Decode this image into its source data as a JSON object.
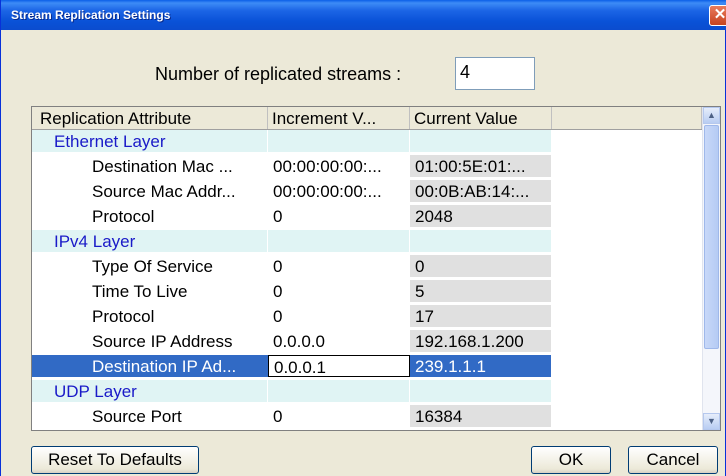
{
  "window": {
    "title": "Stream Replication Settings"
  },
  "num_streams": {
    "label": "Number of replicated streams  :",
    "value": "4"
  },
  "columns": [
    "Replication Attribute",
    "Increment V...",
    "Current Value"
  ],
  "rows": [
    {
      "attr": "Ethernet Layer",
      "incr": "",
      "cur": "",
      "group": true
    },
    {
      "attr": "Destination Mac ...",
      "incr": "00:00:00:00:...",
      "cur": "01:00:5E:01:..."
    },
    {
      "attr": "Source Mac Addr...",
      "incr": "00:00:00:00:...",
      "cur": "00:0B:AB:14:..."
    },
    {
      "attr": "Protocol",
      "incr": "0",
      "cur": "2048"
    },
    {
      "attr": "IPv4 Layer",
      "incr": "",
      "cur": "",
      "group": true
    },
    {
      "attr": "Type Of Service",
      "incr": "0",
      "cur": "0"
    },
    {
      "attr": "Time To Live",
      "incr": "0",
      "cur": "5"
    },
    {
      "attr": "Protocol",
      "incr": "0",
      "cur": "17"
    },
    {
      "attr": "Source IP Address",
      "incr": "0.0.0.0",
      "cur": "192.168.1.200"
    },
    {
      "attr": "Destination IP Ad...",
      "incr": "0.0.0.1",
      "cur": "239.1.1.1",
      "selected": true
    },
    {
      "attr": "UDP Layer",
      "incr": "",
      "cur": "",
      "group": true
    },
    {
      "attr": "Source Port",
      "incr": "0",
      "cur": "16384"
    }
  ],
  "buttons": {
    "reset": "Reset To Defaults",
    "ok": "OK",
    "cancel": "Cancel"
  },
  "icons": {
    "close": "close-icon",
    "scroll_up": "arrow-up-icon",
    "scroll_down": "arrow-down-icon"
  }
}
